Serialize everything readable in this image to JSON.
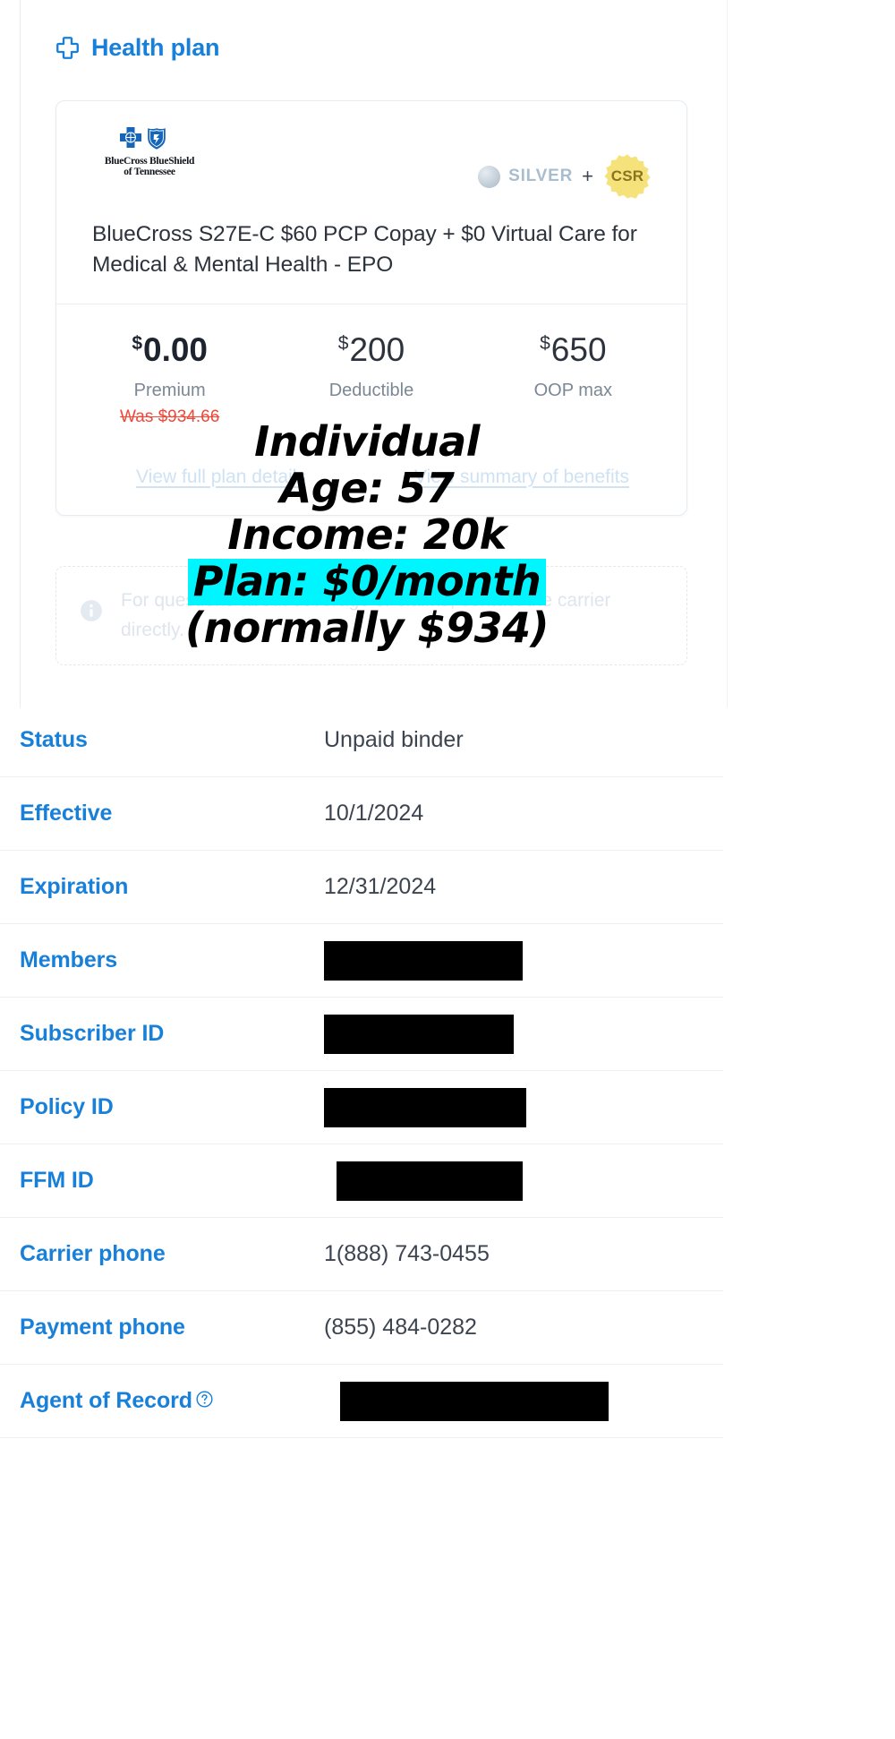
{
  "section": {
    "title": "Health plan",
    "icon": "medical-cross-icon"
  },
  "plan_card": {
    "carrier": {
      "logo_line1": "BlueCross BlueShield",
      "logo_line2": "of Tennessee"
    },
    "metal_level": "SILVER",
    "plus_sign": "+",
    "csr_badge": "CSR",
    "plan_name": "BlueCross S27E-C $60 PCP Copay + $0 Virtual Care for Medical & Mental Health - EPO",
    "prices": [
      {
        "currency": "$",
        "amount": "0.00",
        "label": "Premium",
        "was": "Was $934.66"
      },
      {
        "currency": "$",
        "amount": "200",
        "label": "Deductible",
        "was": ""
      },
      {
        "currency": "$",
        "amount": "650",
        "label": "OOP max",
        "was": ""
      }
    ],
    "links": [
      "View full plan details",
      "View summary of benefits"
    ]
  },
  "info_notice": {
    "icon": "info-circle-icon",
    "text": "For questions about coverage or claims, contact the carrier directly."
  },
  "details": {
    "rows": [
      {
        "label": "Status",
        "value": "Unpaid binder",
        "redacted": false,
        "redaction_width": 0,
        "help": false
      },
      {
        "label": "Effective",
        "value": "10/1/2024",
        "redacted": false,
        "redaction_width": 0,
        "help": false
      },
      {
        "label": "Expiration",
        "value": "12/31/2024",
        "redacted": false,
        "redaction_width": 0,
        "help": false
      },
      {
        "label": "Members",
        "value": "",
        "redacted": true,
        "redaction_width": 222,
        "help": false
      },
      {
        "label": "Subscriber ID",
        "value": "",
        "redacted": true,
        "redaction_width": 212,
        "help": false
      },
      {
        "label": "Policy ID",
        "value": "",
        "redacted": true,
        "redaction_width": 226,
        "help": false
      },
      {
        "label": "FFM ID",
        "value": "",
        "redacted": true,
        "redaction_width": 208,
        "help": false
      },
      {
        "label": "Carrier phone",
        "value": "1(888) 743-0455",
        "redacted": false,
        "redaction_width": 0,
        "help": false
      },
      {
        "label": "Payment phone",
        "value": "(855) 484-0282",
        "redacted": false,
        "redaction_width": 0,
        "help": false
      },
      {
        "label": "Agent of Record",
        "value": "",
        "redacted": true,
        "redaction_width": 300,
        "help": true
      }
    ]
  },
  "annotation": {
    "line1": "Individual",
    "line2": "Age: 57",
    "line3": "Income: 20k",
    "line4": "Plan: $0/month",
    "line5": "(normally $934)",
    "highlight_color": "#00F6FF"
  }
}
